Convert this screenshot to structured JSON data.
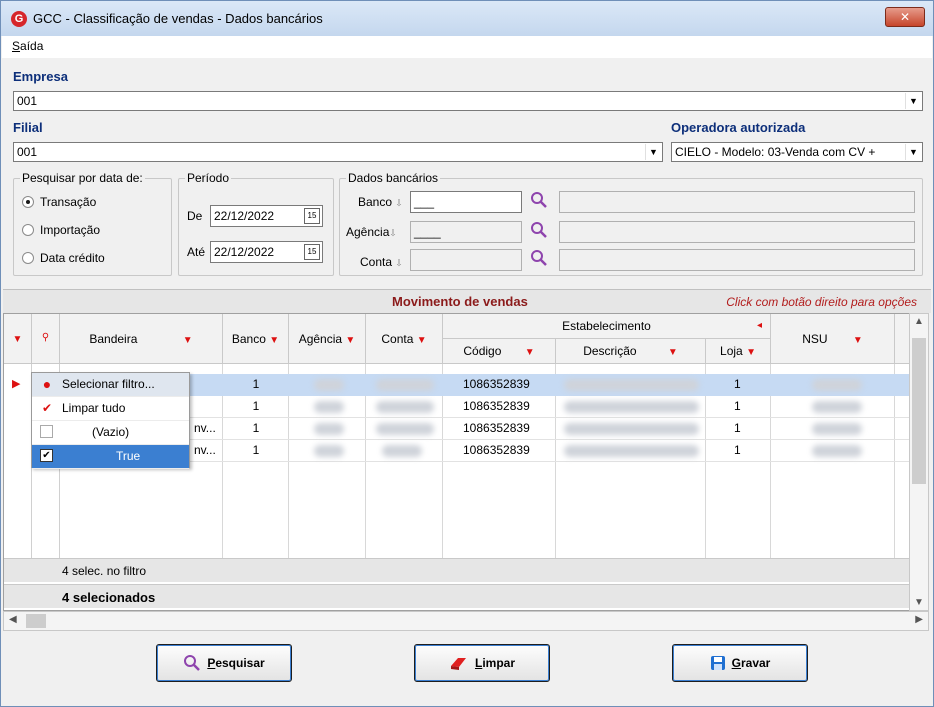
{
  "window": {
    "title": "GCC - Classificação de vendas - Dados bancários",
    "close_glyph": "✕"
  },
  "menu": {
    "items": [
      {
        "label_first": "S",
        "label_rest": "aída"
      }
    ]
  },
  "empresa": {
    "label": "Empresa",
    "value": "001"
  },
  "filial": {
    "label": "Filial",
    "value": "001"
  },
  "operadora": {
    "label": "Operadora autorizada",
    "value": "CIELO - Modelo: 03-Venda com CV +"
  },
  "pesquisar": {
    "title": "Pesquisar por data de:",
    "options": [
      "Transação",
      "Importação",
      "Data crédito"
    ],
    "selected": "Transação"
  },
  "periodo": {
    "title": "Período",
    "de_label": "De",
    "de_value": "22/12/2022",
    "ate_label": "Até",
    "ate_value": "22/12/2022",
    "cal_glyph": "15"
  },
  "dados_bancarios": {
    "title": "Dados bancários",
    "banco_label": "Banco",
    "banco_value": "___",
    "agencia_label": "Agência",
    "agencia_value": "____",
    "conta_label": "Conta",
    "conta_value": ""
  },
  "grid": {
    "title": "Movimento de vendas",
    "hint": "Click com botão direito para opções",
    "columns": {
      "bandeira": "Bandeira",
      "banco": "Banco",
      "agencia": "Agência",
      "conta": "Conta",
      "estabelecimento": "Estabelecimento",
      "codigo": "Código",
      "descricao": "Descrição",
      "loja": "Loja",
      "nsu": "NSU"
    },
    "rows": [
      {
        "bandeira": "",
        "banco": "1",
        "codigo": "1086352839",
        "loja": "1"
      },
      {
        "bandeira": "",
        "banco": "1",
        "codigo": "1086352839",
        "loja": "1"
      },
      {
        "bandeira": "nv...",
        "banco": "1",
        "codigo": "1086352839",
        "loja": "1"
      },
      {
        "bandeira": "nv...",
        "banco": "1",
        "codigo": "1086352839",
        "loja": "1"
      }
    ],
    "footer_filter": "4 selec. no filtro",
    "footer_selected": "4 selecionados",
    "popup": [
      {
        "label": "Selecionar filtro...",
        "icon": "dot-icon"
      },
      {
        "label": "Limpar tudo",
        "icon": "check-icon"
      },
      {
        "label": "(Vazio)",
        "icon": "checkbox-unchecked-icon"
      },
      {
        "label": "True",
        "icon": "checkbox-checked-icon"
      }
    ]
  },
  "buttons": {
    "pesquisar": {
      "first": "P",
      "rest": "esquisar"
    },
    "limpar": {
      "first": "L",
      "rest": "impar"
    },
    "gravar": {
      "first": "G",
      "rest": "ravar"
    }
  },
  "colors": {
    "accent_red": "#d11111",
    "title_blue": "#0d2f7a",
    "selection": "#3b7fd1"
  }
}
